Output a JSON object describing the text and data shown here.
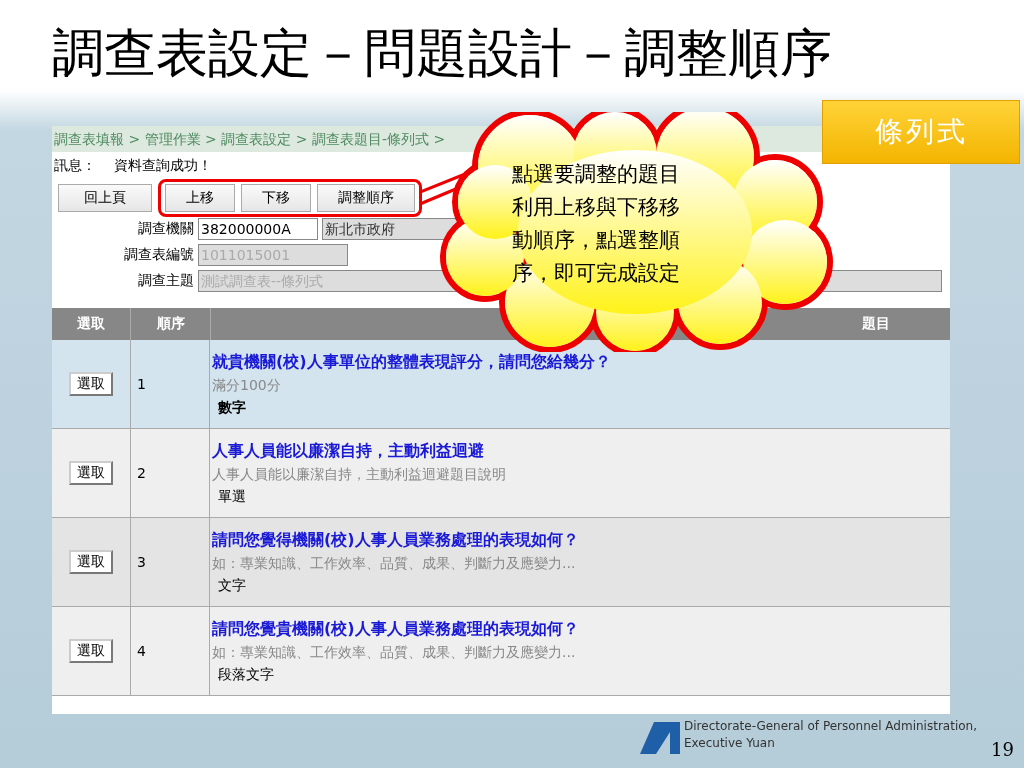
{
  "slide": {
    "title": "調查表設定－問題設計－調整順序",
    "tag": "條列式",
    "page_number": "19",
    "footer_lines": [
      "Directorate-General of Personnel Administration,",
      "Executive Yuan"
    ]
  },
  "screen": {
    "breadcrumb": "調查表填報 > 管理作業 > 調查表設定 > 調查表題目-條列式 >",
    "message": {
      "label": "訊息：",
      "text": "資料查詢成功！"
    },
    "buttons": [
      {
        "label": "回上頁",
        "highlighted": false
      },
      {
        "label": "上移",
        "highlighted": true
      },
      {
        "label": "下移",
        "highlighted": true
      },
      {
        "label": "調整順序",
        "highlighted": true
      }
    ],
    "fields": [
      {
        "label": "調查機關",
        "inputs": [
          {
            "value": "382000000A",
            "disabled": false
          },
          {
            "value": "新北市政府",
            "disabled": true
          }
        ]
      },
      {
        "label": "調查表編號",
        "inputs": [
          {
            "value": "1011015001",
            "disabled": true
          }
        ]
      },
      {
        "label": "調查主題",
        "inputs": [
          {
            "value": "測試調查表--條列式",
            "disabled": true
          }
        ]
      }
    ],
    "table": {
      "columns": [
        "選取",
        "順序",
        "題目"
      ],
      "rows": [
        {
          "select_button": "選取",
          "order": "1",
          "title": "就貴機關(校)人事單位的整體表現評分，請問您給幾分？",
          "description": "滿分100分",
          "type": "數字",
          "selected": true
        },
        {
          "select_button": "選取",
          "order": "2",
          "title": "人事人員能以廉潔自持，主動利益迴避",
          "description": "人事人員能以廉潔自持，主動利益迴避題目說明",
          "type": "單選",
          "selected": false
        },
        {
          "select_button": "選取",
          "order": "3",
          "title": "請問您覺得機關(校)人事人員業務處理的表現如何？",
          "description": "如：專業知識、工作效率、品質、成果、判斷力及應變力...",
          "type": "文字",
          "selected": false
        },
        {
          "select_button": "選取",
          "order": "4",
          "title": "請問您覺貴機關(校)人事人員業務處理的表現如何？",
          "description": "如：專業知識、工作效率、品質、成果、判斷力及應變力...",
          "type": "段落文字",
          "selected": false
        }
      ]
    }
  },
  "callout": {
    "lines": [
      "點選要調整的題目",
      "利用上移與下移移",
      "動順序，點選整順",
      "序，即可完成設定"
    ]
  }
}
